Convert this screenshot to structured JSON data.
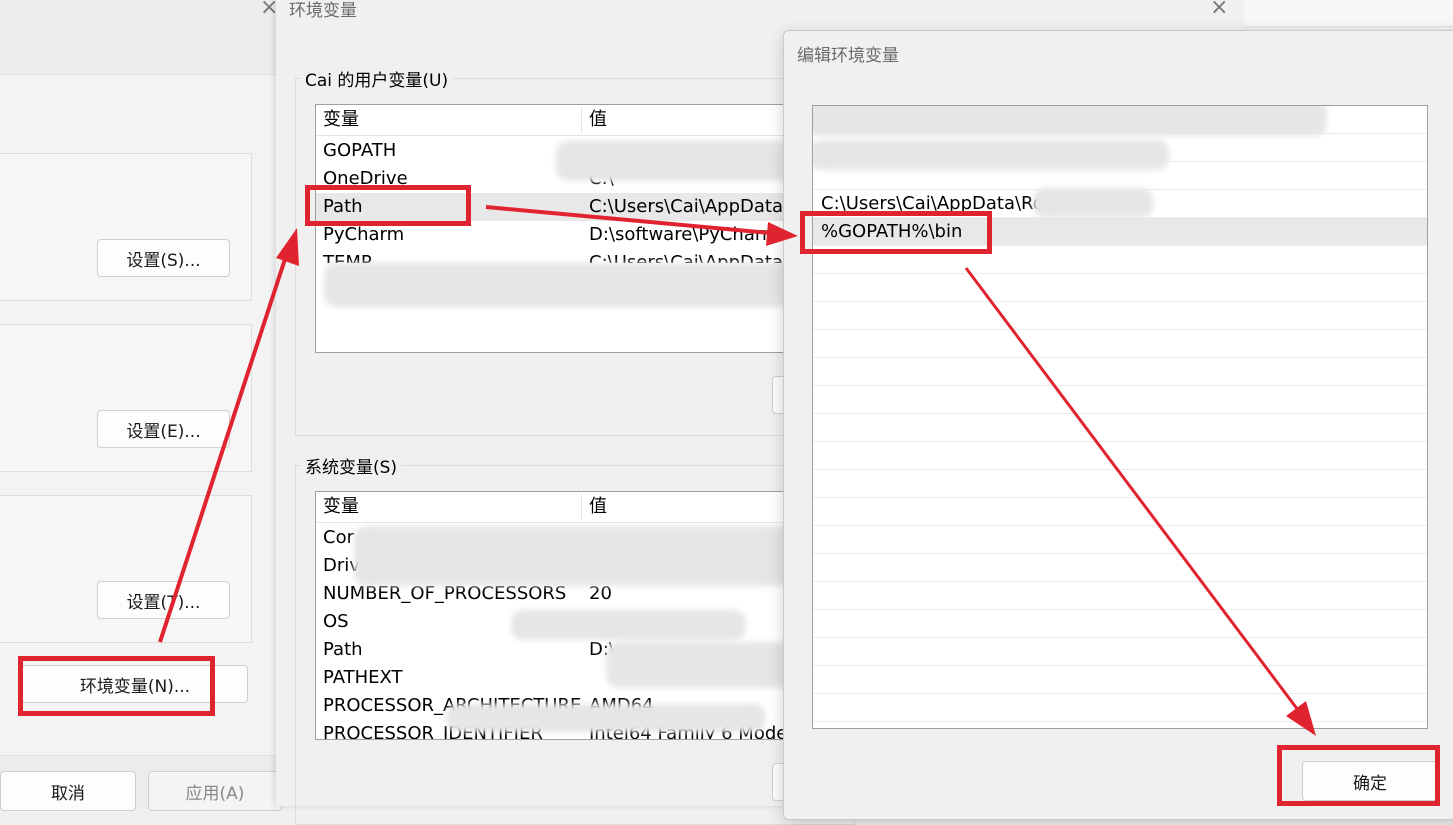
{
  "left_dialog": {
    "buttons": {
      "settings_s": "设置(S)...",
      "settings_e": "设置(E)...",
      "settings_t": "设置(T)...",
      "env_vars": "环境变量(N)...",
      "cancel": "取消",
      "apply": "应用(A)"
    }
  },
  "env_dialog": {
    "title": "环境变量",
    "user_group_label": "Cai 的用户变量(U)",
    "system_group_label": "系统变量(S)",
    "column_var": "变量",
    "column_val": "值",
    "user_vars": [
      {
        "name": "GOPATH",
        "value": ""
      },
      {
        "name": "OneDrive",
        "value": "C:\\"
      },
      {
        "name": "Path",
        "value": "C:\\Users\\Cai\\AppData\\"
      },
      {
        "name": "PyCharm",
        "value": "D:\\software\\PyCharm"
      },
      {
        "name": "TEMP",
        "value": "C:\\Users\\Cai\\AppData"
      }
    ],
    "system_vars": [
      {
        "name": "Cor",
        "value": ""
      },
      {
        "name": "Drive",
        "value": ""
      },
      {
        "name": "NUMBER_OF_PROCESSORS",
        "value": "20"
      },
      {
        "name": "OS",
        "value": ""
      },
      {
        "name": "Path",
        "value": "D:\\"
      },
      {
        "name": "PATHEXT",
        "value": ""
      },
      {
        "name": "PROCESSOR_ARCHITECTURE",
        "value": "AMD64"
      },
      {
        "name": "PROCESSOR_IDENTIFIER",
        "value": "Intel64 Family 6 Mode"
      }
    ]
  },
  "edit_dialog": {
    "title": "编辑环境变量",
    "entries": [
      "",
      "",
      "",
      "C:\\Users\\Cai\\AppData\\Ro",
      "%GOPATH%\\bin"
    ],
    "ok_button": "确定"
  },
  "colors": {
    "annotation_red": "#e0242f",
    "selected_row": "#e8e8e8"
  }
}
